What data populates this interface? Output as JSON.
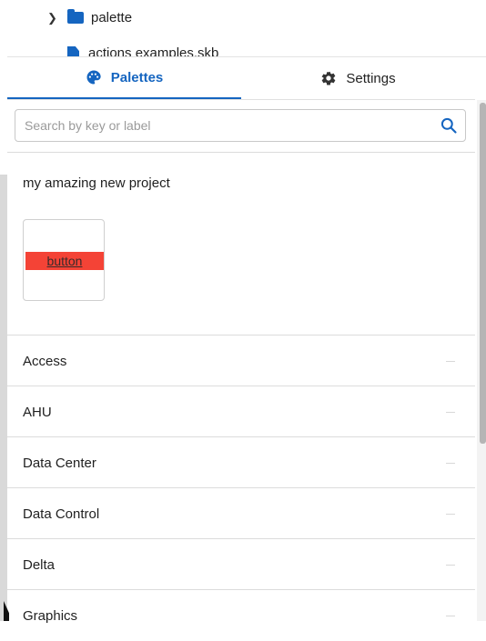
{
  "tree": {
    "folder_label": "palette",
    "file_label": "actions examples.skb"
  },
  "tabs": [
    {
      "label": "Palettes",
      "active": true,
      "icon": "palette-icon"
    },
    {
      "label": "Settings",
      "active": false,
      "icon": "gear-icon"
    }
  ],
  "search": {
    "placeholder": "Search by key or label",
    "value": "",
    "icon": "search-icon"
  },
  "project": {
    "title": "my amazing new project",
    "palette_item_label": "button"
  },
  "categories": [
    {
      "label": "Access"
    },
    {
      "label": "AHU"
    },
    {
      "label": "Data Center"
    },
    {
      "label": "Data Control"
    },
    {
      "label": "Delta"
    },
    {
      "label": "Graphics"
    }
  ],
  "colors": {
    "accent": "#1565c0",
    "button_preview": "#f44336"
  }
}
